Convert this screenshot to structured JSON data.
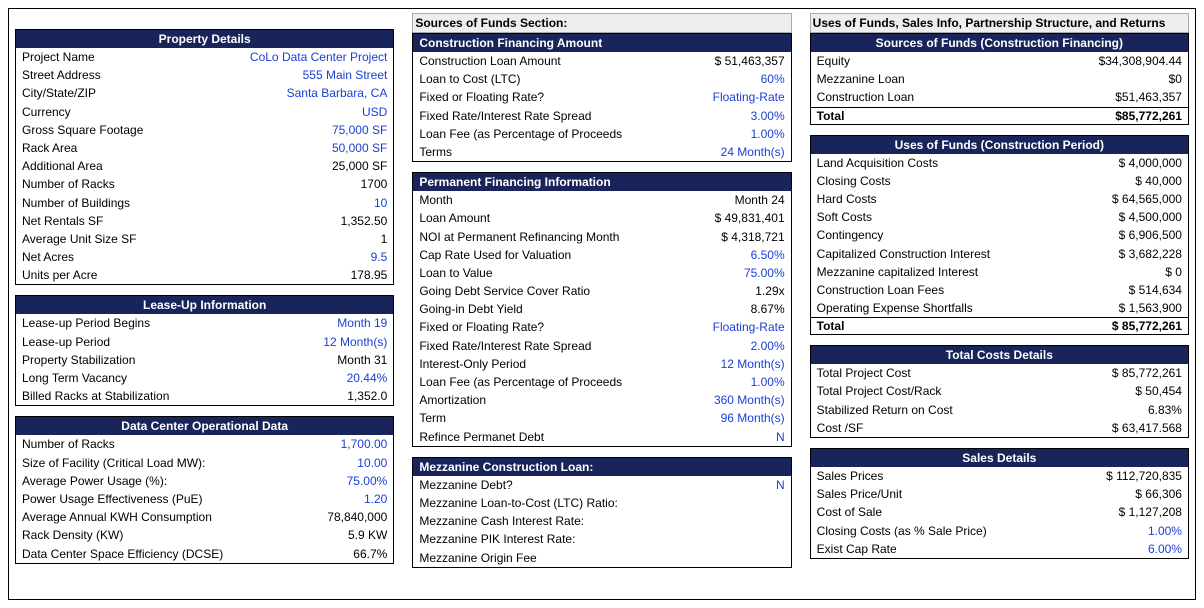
{
  "col1": {
    "property_details": {
      "title": "Property Details",
      "rows": [
        {
          "label": "Project Name",
          "value": "CoLo Data Center Project",
          "blue": true
        },
        {
          "label": "Street Address",
          "value": "555 Main Street",
          "blue": true
        },
        {
          "label": "City/State/ZIP",
          "value": "Santa Barbara, CA",
          "blue": true
        },
        {
          "label": "Currency",
          "value": "USD",
          "blue": true
        },
        {
          "label": "Gross Square Footage",
          "value": "75,000 SF",
          "blue": true
        },
        {
          "label": "Rack Area",
          "value": "50,000 SF",
          "blue": true
        },
        {
          "label": "Additional Area",
          "value": "25,000 SF",
          "blue": false
        },
        {
          "label": "Number of Racks",
          "value": "1700",
          "blue": false
        },
        {
          "label": "Number of Buildings",
          "value": "10",
          "blue": true
        },
        {
          "label": "Net Rentals SF",
          "value": "1,352.50",
          "blue": false
        },
        {
          "label": "Average Unit Size SF",
          "value": "1",
          "blue": false
        },
        {
          "label": "Net Acres",
          "value": "9.5",
          "blue": true
        },
        {
          "label": "Units per Acre",
          "value": "178.95",
          "blue": false
        }
      ]
    },
    "lease_up": {
      "title": "Lease-Up Information",
      "rows": [
        {
          "label": "Lease-up Period Begins",
          "value": "Month 19",
          "blue": true
        },
        {
          "label": "Lease-up Period",
          "value": "12 Month(s)",
          "blue": true
        },
        {
          "label": "Property Stabilization",
          "value": "Month 31",
          "blue": false
        },
        {
          "label": "Long Term Vacancy",
          "value": "20.44%",
          "blue": true
        },
        {
          "label": "Billed Racks at Stabilization",
          "value": "1,352.0",
          "blue": false
        }
      ]
    },
    "op_data": {
      "title": "Data Center Operational Data",
      "rows": [
        {
          "label": "Number of Racks",
          "value": "1,700.00",
          "blue": true
        },
        {
          "label": "Size of Facility (Critical Load MW):",
          "value": "10.00",
          "blue": true
        },
        {
          "label": "Average Power Usage (%):",
          "value": "75.00%",
          "blue": true
        },
        {
          "label": "Power Usage Effectiveness (PuE)",
          "value": "1.20",
          "blue": true
        },
        {
          "label": "Average Annual KWH Consumption",
          "value": "78,840,000",
          "blue": false
        },
        {
          "label": "Rack Density (KW)",
          "value": "5.9 KW",
          "blue": false
        },
        {
          "label": "Data Center Space Efficiency (DCSE)",
          "value": "66.7%",
          "blue": false
        }
      ]
    }
  },
  "col2": {
    "section_label": "Sources of Funds Section:",
    "construction_financing": {
      "title": "Construction Financing Amount",
      "rows": [
        {
          "label": "Construction Loan Amount",
          "value": "$ 51,463,357",
          "blue": false
        },
        {
          "label": "Loan to Cost (LTC)",
          "value": "60%",
          "blue": true
        },
        {
          "label": "Fixed or Floating Rate?",
          "value": "Floating-Rate",
          "blue": true
        },
        {
          "label": "Fixed Rate/Interest Rate Spread",
          "value": "3.00%",
          "blue": true
        },
        {
          "label": "Loan Fee (as Percentage of Proceeds",
          "value": "1.00%",
          "blue": true
        },
        {
          "label": "Terms",
          "value": "24 Month(s)",
          "blue": true
        }
      ]
    },
    "perm_financing": {
      "title": "Permanent Financing Information",
      "rows": [
        {
          "label": "Month",
          "value": "Month 24",
          "blue": false
        },
        {
          "label": "Loan Amount",
          "value": "$ 49,831,401",
          "blue": false
        },
        {
          "label": "NOI at Permanent Refinancing Month",
          "value": "$ 4,318,721",
          "blue": false
        },
        {
          "label": "Cap Rate Used for Valuation",
          "value": "6.50%",
          "blue": true
        },
        {
          "label": "Loan to Value",
          "value": "75.00%",
          "blue": true
        },
        {
          "label": "Going Debt Service Cover Ratio",
          "value": "1.29x",
          "blue": false
        },
        {
          "label": "Going-in Debt Yield",
          "value": "8.67%",
          "blue": false
        },
        {
          "label": "Fixed or Floating Rate?",
          "value": "Floating-Rate",
          "blue": true
        },
        {
          "label": "Fixed Rate/Interest Rate Spread",
          "value": "2.00%",
          "blue": true
        },
        {
          "label": "Interest-Only Period",
          "value": "12 Month(s)",
          "blue": true
        },
        {
          "label": "Loan Fee (as Percentage of Proceeds",
          "value": "1.00%",
          "blue": true
        },
        {
          "label": "Amortization",
          "value": "360 Month(s)",
          "blue": true
        },
        {
          "label": "Term",
          "value": "96 Month(s)",
          "blue": true
        },
        {
          "label": "Refince Permanet Debt",
          "value": "N",
          "blue": true
        }
      ]
    },
    "mezz": {
      "title": "Mezzanine Construction Loan:",
      "rows": [
        {
          "label": "Mezzanine Debt?",
          "value": "N",
          "blue": true
        },
        {
          "label": "Mezzanine Loan-to-Cost (LTC) Ratio:",
          "value": "",
          "blue": false
        },
        {
          "label": "Mezzanine Cash Interest Rate:",
          "value": "",
          "blue": false
        },
        {
          "label": "Mezzanine PIK Interest Rate:",
          "value": "",
          "blue": false
        },
        {
          "label": "Mezzanine Origin Fee",
          "value": "",
          "blue": false
        }
      ]
    }
  },
  "col3": {
    "section_label": "Uses of Funds, Sales Info, Partnership Structure, and Returns",
    "sources": {
      "title": "Sources of Funds (Construction Financing)",
      "rows": [
        {
          "label": "Equity",
          "value": "$34,308,904.44"
        },
        {
          "label": "Mezzanine Loan",
          "value": "$0"
        },
        {
          "label": "Construction Loan",
          "value": "$51,463,357"
        }
      ],
      "total_label": "Total",
      "total_value": "$85,772,261"
    },
    "uses": {
      "title": "Uses of Funds (Construction Period)",
      "rows": [
        {
          "label": "Land Acquisition Costs",
          "value": "$ 4,000,000"
        },
        {
          "label": "Closing Costs",
          "value": "$ 40,000"
        },
        {
          "label": "Hard Costs",
          "value": "$ 64,565,000"
        },
        {
          "label": "Soft Costs",
          "value": "$ 4,500,000"
        },
        {
          "label": "Contingency",
          "value": "$ 6,906,500"
        },
        {
          "label": "Capitalized Construction Interest",
          "value": "$ 3,682,228"
        },
        {
          "label": "Mezzanine capitalized Interest",
          "value": "$ 0"
        },
        {
          "label": "Construction Loan Fees",
          "value": "$ 514,634"
        },
        {
          "label": "Operating Expense Shortfalls",
          "value": "$ 1,563,900"
        }
      ],
      "total_label": "Total",
      "total_value": "$ 85,772,261"
    },
    "total_costs": {
      "title": "Total Costs Details",
      "rows": [
        {
          "label": "Total Project Cost",
          "value": "$ 85,772,261"
        },
        {
          "label": "Total Project Cost/Rack",
          "value": "$ 50,454"
        },
        {
          "label": "Stabilized Return on Cost",
          "value": "6.83%"
        },
        {
          "label": "Cost /SF",
          "value": "$ 63,417.568"
        }
      ]
    },
    "sales": {
      "title": "Sales Details",
      "rows": [
        {
          "label": "Sales Prices",
          "value": "$ 112,720,835",
          "blue": false
        },
        {
          "label": "Sales Price/Unit",
          "value": "$ 66,306",
          "blue": false
        },
        {
          "label": "Cost of Sale",
          "value": "$ 1,127,208",
          "blue": false
        },
        {
          "label": "Closing Costs (as % Sale Price)",
          "value": "1.00%",
          "blue": true
        },
        {
          "label": "Exist Cap Rate",
          "value": "6.00%",
          "blue": true
        }
      ]
    }
  }
}
